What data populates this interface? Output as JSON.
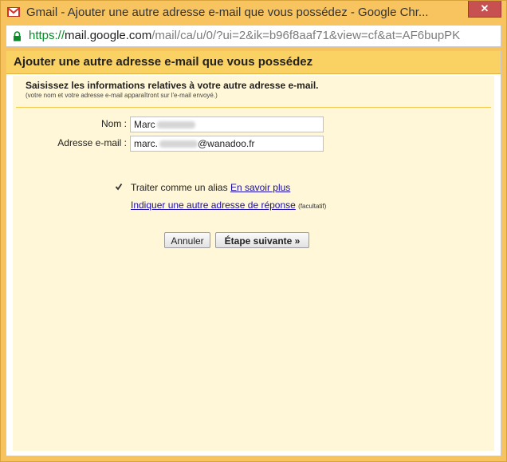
{
  "window": {
    "title": "Gmail - Ajouter une autre adresse e-mail que vous possédez - Google Chr...",
    "close_label": "✕"
  },
  "address_bar": {
    "protocol": "https://",
    "host": "mail.google.com",
    "path": "/mail/ca/u/0/?ui=2&ik=b96f8aaf71&view=cf&at=AF6bupPK"
  },
  "page": {
    "heading": "Ajouter une autre adresse e-mail que vous possédez",
    "instructions": "Saisissez les informations relatives à votre autre adresse e-mail.",
    "instructions_note": "(votre nom et votre adresse e-mail apparaîtront sur l'e-mail envoyé.)"
  },
  "form": {
    "name_label": "Nom :",
    "name_value": "Marc",
    "email_label": "Adresse e-mail :",
    "email_value_start": "marc.",
    "email_value_end": "@wanadoo.fr",
    "alias_checked": true,
    "alias_label": "Traiter comme un alias",
    "learn_more_link": "En savoir plus",
    "reply_to_link": "Indiquer une autre adresse de réponse",
    "optional_note": "(facultatif)"
  },
  "buttons": {
    "cancel": "Annuler",
    "next": "Étape suivante »"
  }
}
